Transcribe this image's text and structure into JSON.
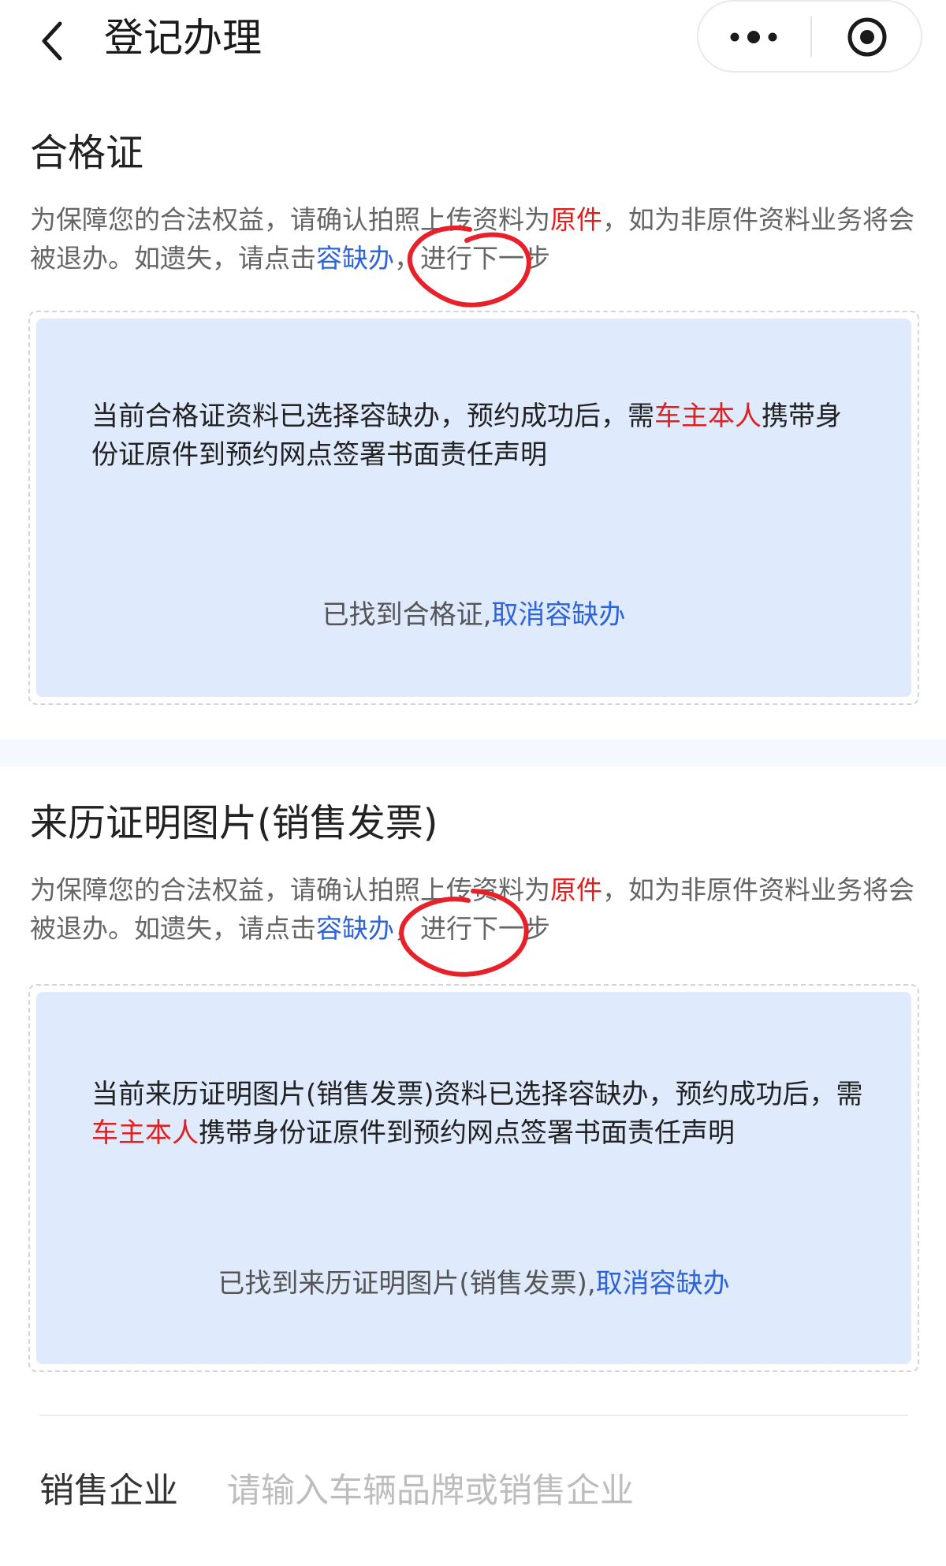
{
  "header": {
    "title": "登记办理",
    "back_icon": "chevron-left-icon",
    "more_icon": "more-dots-icon",
    "circle_icon": "target-circle-icon"
  },
  "sections": [
    {
      "title": "合格证",
      "notice": {
        "part1": "为保障您的合法权益，请确认拍照上传资料为",
        "highlight": "原件",
        "part2": "，如为非原件资料业务将会被退办。如遗失，请点击",
        "link": "容缺办",
        "part3": "，进行下一步"
      },
      "card": {
        "msg_part1": "当前合格证资料已选择容缺办，预约成功后，需",
        "msg_highlight": "车主本人",
        "msg_part2": "携带身份证原件到预约网点签署书面责任声明",
        "status_text": "已找到合格证,",
        "cancel_link": "取消容缺办"
      }
    },
    {
      "title": "来历证明图片(销售发票)",
      "notice": {
        "part1": "为保障您的合法权益，请确认拍照上传资料为",
        "highlight": "原件",
        "part2": "，如为非原件资料业务将会被退办。如遗失，请点击",
        "link": "容缺办",
        "part3": "，进行下一步"
      },
      "card": {
        "msg_part1": "当前来历证明图片(销售发票)资料已选择容缺办，预约成功后，需",
        "msg_highlight": "车主本人",
        "msg_part2": "携带身份证原件到预约网点签署书面责任声明",
        "status_text": "已找到来历证明图片(销售发票),",
        "cancel_link": "取消容缺办"
      }
    }
  ],
  "sales_field": {
    "label": "销售企业",
    "placeholder": "请输入车辆品牌或销售企业",
    "value": ""
  },
  "colors": {
    "accent_link": "#2f64d8",
    "highlight_red": "#e02020",
    "card_bg": "#dfeafc",
    "annotation": "#e8202a"
  }
}
